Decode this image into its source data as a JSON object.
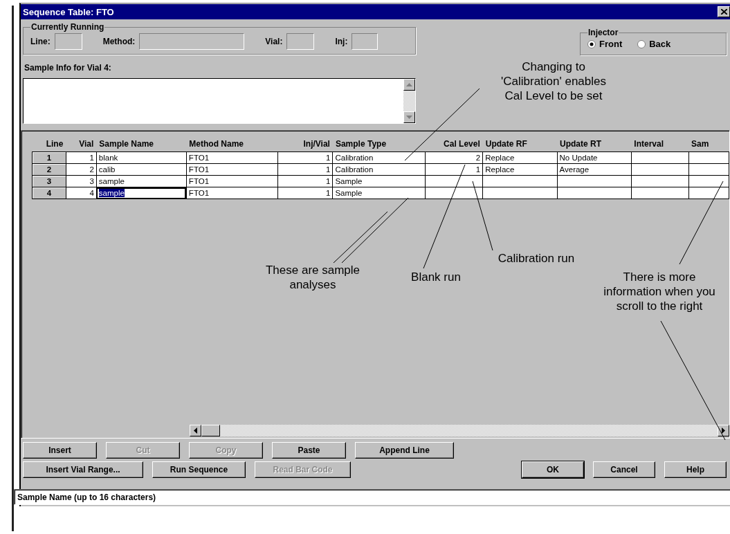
{
  "window": {
    "title": "Sequence Table: FTO"
  },
  "currently_running": {
    "title": "Currently Running",
    "fields": [
      {
        "label": "Line:"
      },
      {
        "label": "Method:"
      },
      {
        "label": "Vial:"
      },
      {
        "label": "Inj:"
      }
    ]
  },
  "injector": {
    "title": "Injector",
    "options": [
      {
        "label": "Front",
        "selected": true
      },
      {
        "label": "Back",
        "selected": false
      }
    ]
  },
  "sample_info": {
    "label": "Sample Info for Vial 4:"
  },
  "table": {
    "columns": [
      "Line",
      "Vial",
      "Sample Name",
      "Method Name",
      "Inj/Vial",
      "Sample Type",
      "Cal Level",
      "Update RF",
      "Update RT",
      "Interval",
      "Sam"
    ],
    "rows": [
      {
        "line": "1",
        "vial": "1",
        "sample_name": "blank",
        "method_name": "FTO1",
        "inj_per_vial": "1",
        "sample_type": "Calibration",
        "cal_level": "2",
        "update_rf": "Replace",
        "update_rt": "No Update",
        "selected": false
      },
      {
        "line": "2",
        "vial": "2",
        "sample_name": "calib",
        "method_name": "FTO1",
        "inj_per_vial": "1",
        "sample_type": "Calibration",
        "cal_level": "1",
        "update_rf": "Replace",
        "update_rt": "Average",
        "selected": false
      },
      {
        "line": "3",
        "vial": "3",
        "sample_name": "sample",
        "method_name": "FTO1",
        "inj_per_vial": "1",
        "sample_type": "Sample",
        "selected": false
      },
      {
        "line": "4",
        "vial": "4",
        "sample_name": "sample",
        "method_name": "FTO1",
        "inj_per_vial": "1",
        "sample_type": "Sample",
        "selected": true
      }
    ]
  },
  "annotations": [
    {
      "text": "Changing to\n'Calibration' enables\nCal Level to be set"
    },
    {
      "text": "These are sample\nanalyses"
    },
    {
      "text": "Blank run"
    },
    {
      "text": "Calibration run"
    },
    {
      "text": "There is more\ninformation when you\nscroll to the right"
    }
  ],
  "edit_buttons": [
    {
      "label": "Insert",
      "disabled": false
    },
    {
      "label": "Cut",
      "disabled": true
    },
    {
      "label": "Copy",
      "disabled": true
    },
    {
      "label": "Paste",
      "disabled": false
    },
    {
      "label": "Append Line",
      "disabled": false
    }
  ],
  "sequence_buttons": [
    {
      "label": "Insert Vial Range...",
      "disabled": false
    },
    {
      "label": "Run Sequence",
      "disabled": false
    },
    {
      "label": "Read Bar Code",
      "disabled": true
    }
  ],
  "dialog_buttons": [
    {
      "label": "OK",
      "default": true
    },
    {
      "label": "Cancel",
      "default": false
    },
    {
      "label": "Help",
      "default": false
    }
  ],
  "status_bar": {
    "text": "Sample Name (up to 16 characters)"
  }
}
